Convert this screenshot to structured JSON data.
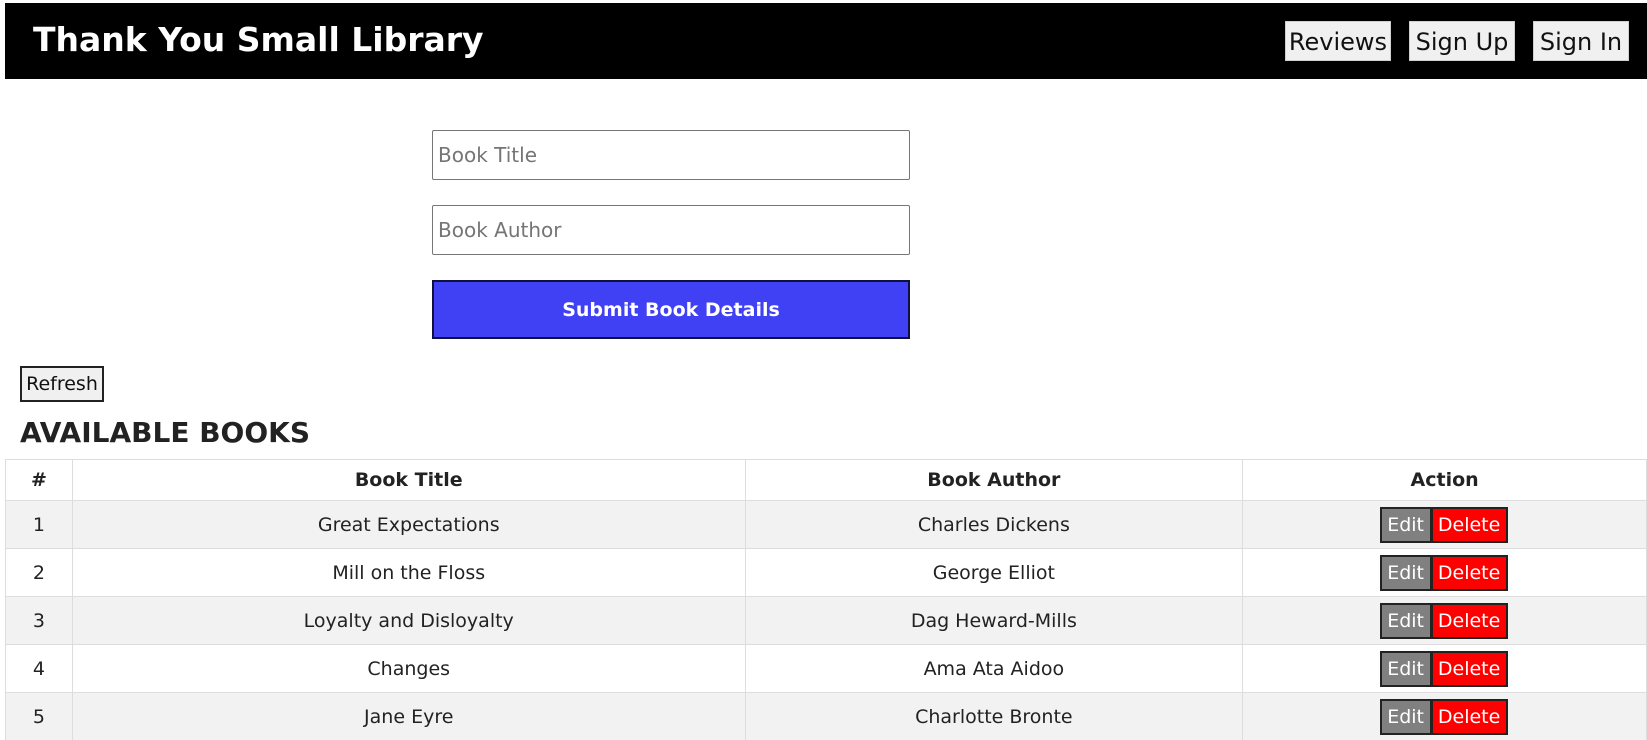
{
  "header": {
    "title": "Thank You Small Library",
    "nav": [
      "Reviews",
      "Sign Up",
      "Sign In"
    ]
  },
  "form": {
    "title_placeholder": "Book Title",
    "author_placeholder": "Book Author",
    "submit_label": "Submit Book Details"
  },
  "refresh_label": "Refresh",
  "section_title": "AVAILABLE BOOKS",
  "table": {
    "columns": [
      "#",
      "Book Title",
      "Book Author",
      "Action"
    ],
    "rows": [
      {
        "num": "1",
        "title": "Great Expectations",
        "author": "Charles Dickens"
      },
      {
        "num": "2",
        "title": "Mill on the Floss",
        "author": "George Elliot"
      },
      {
        "num": "3",
        "title": "Loyalty and Disloyalty",
        "author": "Dag Heward-Mills"
      },
      {
        "num": "4",
        "title": "Changes",
        "author": "Ama Ata Aidoo"
      },
      {
        "num": "5",
        "title": "Jane Eyre",
        "author": "Charlotte Bronte"
      }
    ],
    "edit_label": "Edit",
    "delete_label": "Delete"
  },
  "colors": {
    "header_bg": "#000000",
    "submit_bg": "#4040f5",
    "edit_bg": "#808080",
    "delete_bg": "#ff0000"
  }
}
